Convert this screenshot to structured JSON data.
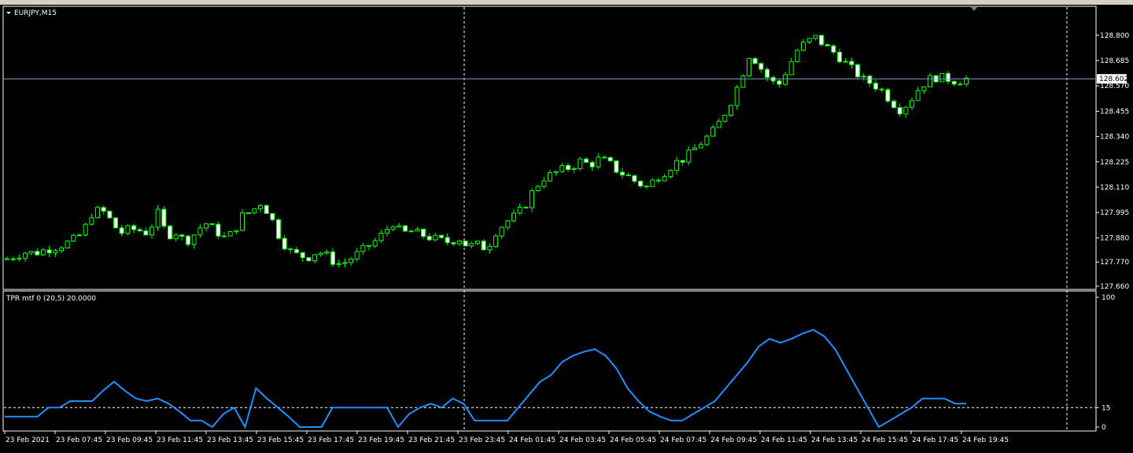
{
  "main_panel": {
    "symbol_label": "EURJPY,M15",
    "current_price_label": "128.602"
  },
  "indicator_panel": {
    "label": "TPR mtf 0 (20,5) 20.0000"
  },
  "colors": {
    "background": "#000000",
    "candle": "#00ff00",
    "bull_body": "#000000",
    "bear_body": "#ffffff",
    "indicator_line": "#1e90ff",
    "grid_line": "#ffffff",
    "price_line": "#7f9fbf"
  },
  "chart_data": [
    {
      "type": "candlestick",
      "title": "EURJPY,M15",
      "ylim": [
        127.66,
        128.86
      ],
      "y_ticks": [
        "128.800",
        "128.685",
        "128.570",
        "128.455",
        "128.340",
        "128.225",
        "128.110",
        "127.995",
        "127.880",
        "127.770",
        "127.660"
      ],
      "x_ticks": [
        "23 Feb 2021",
        "23 Feb 07:45",
        "23 Feb 09:45",
        "23 Feb 11:45",
        "23 Feb 13:45",
        "23 Feb 15:45",
        "23 Feb 17:45",
        "23 Feb 19:45",
        "23 Feb 21:45",
        "23 Feb 23:45",
        "24 Feb 01:45",
        "24 Feb 03:45",
        "24 Feb 05:45",
        "24 Feb 07:45",
        "24 Feb 09:45",
        "24 Feb 11:45",
        "24 Feb 13:45",
        "24 Feb 15:45",
        "24 Feb 17:45",
        "24 Feb 19:45"
      ],
      "current_price": 128.602,
      "close_path": [
        127.785,
        127.8,
        127.815,
        127.81,
        127.825,
        127.835,
        127.85,
        127.87,
        127.9,
        127.99,
        128.01,
        127.96,
        127.9,
        127.92,
        127.915,
        127.9,
        127.995,
        127.89,
        127.905,
        127.86,
        127.9,
        127.95,
        127.92,
        127.88,
        127.9,
        127.98,
        128.0,
        128.04,
        127.98,
        127.88,
        127.82,
        127.8,
        127.79,
        127.82,
        127.8,
        127.76,
        127.77,
        127.8,
        127.83,
        127.86,
        127.9,
        127.95,
        127.9,
        127.91,
        127.895,
        127.88,
        127.87,
        127.86,
        127.88,
        127.84,
        127.85,
        127.83,
        127.91,
        127.95,
        127.98,
        128.02,
        128.1,
        128.15,
        128.17,
        128.19,
        128.2,
        128.23,
        128.21,
        128.24,
        128.22,
        128.18,
        128.16,
        128.13,
        128.11,
        128.15,
        128.18,
        128.22,
        128.24,
        128.28,
        128.32,
        128.36,
        128.42,
        128.5,
        128.6,
        128.72,
        128.66,
        128.6,
        128.57,
        128.65,
        128.73,
        128.77,
        128.79,
        128.75,
        128.72,
        128.68,
        128.64,
        128.6,
        128.58,
        128.55,
        128.5,
        128.46,
        128.5,
        128.56,
        128.6,
        128.61,
        128.602,
        128.59,
        128.602
      ]
    },
    {
      "type": "line",
      "title": "TPR mtf 0 (20,5) 20.0000",
      "ylim": [
        0,
        100
      ],
      "y_ticks": [
        "100",
        "15",
        "0"
      ],
      "level": 15,
      "values": [
        8,
        8,
        8,
        8,
        15,
        15,
        20,
        20,
        20,
        28,
        35,
        28,
        22,
        20,
        22,
        18,
        12,
        5,
        5,
        0,
        10,
        15,
        0,
        30,
        22,
        15,
        8,
        0,
        0,
        0,
        15,
        15,
        15,
        15,
        15,
        15,
        0,
        10,
        15,
        18,
        15,
        22,
        18,
        5,
        5,
        5,
        5,
        15,
        25,
        35,
        40,
        50,
        55,
        58,
        60,
        55,
        45,
        30,
        20,
        12,
        8,
        5,
        5,
        10,
        15,
        20,
        30,
        40,
        50,
        62,
        68,
        65,
        68,
        72,
        75,
        70,
        60,
        45,
        30,
        15,
        0,
        5,
        10,
        15,
        22,
        22,
        22,
        18,
        18
      ]
    }
  ]
}
